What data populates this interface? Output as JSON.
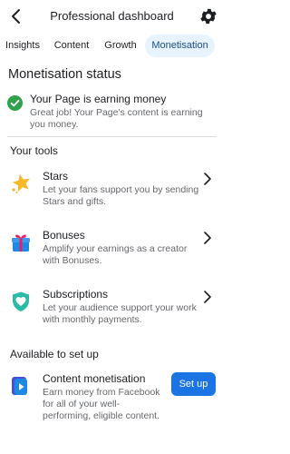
{
  "header": {
    "title": "Professional dashboard",
    "back_icon": "back-arrow-icon",
    "settings_icon": "gear-icon"
  },
  "tabs": [
    {
      "label": "Insights",
      "active": false
    },
    {
      "label": "Content",
      "active": false
    },
    {
      "label": "Growth",
      "active": false
    },
    {
      "label": "Monetisation",
      "active": true
    }
  ],
  "monetisation_status": {
    "heading": "Monetisation status",
    "title": "Your Page is earning money",
    "description": "Great job! Your Page's content is earning you money.",
    "status_color": "#31a24c"
  },
  "tools": {
    "heading": "Your tools",
    "items": [
      {
        "name": "Stars",
        "description": "Let your fans support you by sending Stars and gifts.",
        "icon": "star-icon"
      },
      {
        "name": "Bonuses",
        "description": "Amplify your earnings as a creator with Bonuses.",
        "icon": "gift-icon"
      },
      {
        "name": "Subscriptions",
        "description": "Let your audience support your work with monthly payments.",
        "icon": "subscription-heart-icon"
      }
    ]
  },
  "available": {
    "heading": "Available to set up",
    "item": {
      "name": "Content monetisation",
      "description": "Earn money from Facebook for all of your well-performing, eligible content.",
      "button_label": "Set up",
      "icon": "content-monetisation-icon"
    }
  },
  "colors": {
    "accent": "#1b74e4",
    "active_tab_bg": "#e7f3ff",
    "success": "#31a24c"
  }
}
